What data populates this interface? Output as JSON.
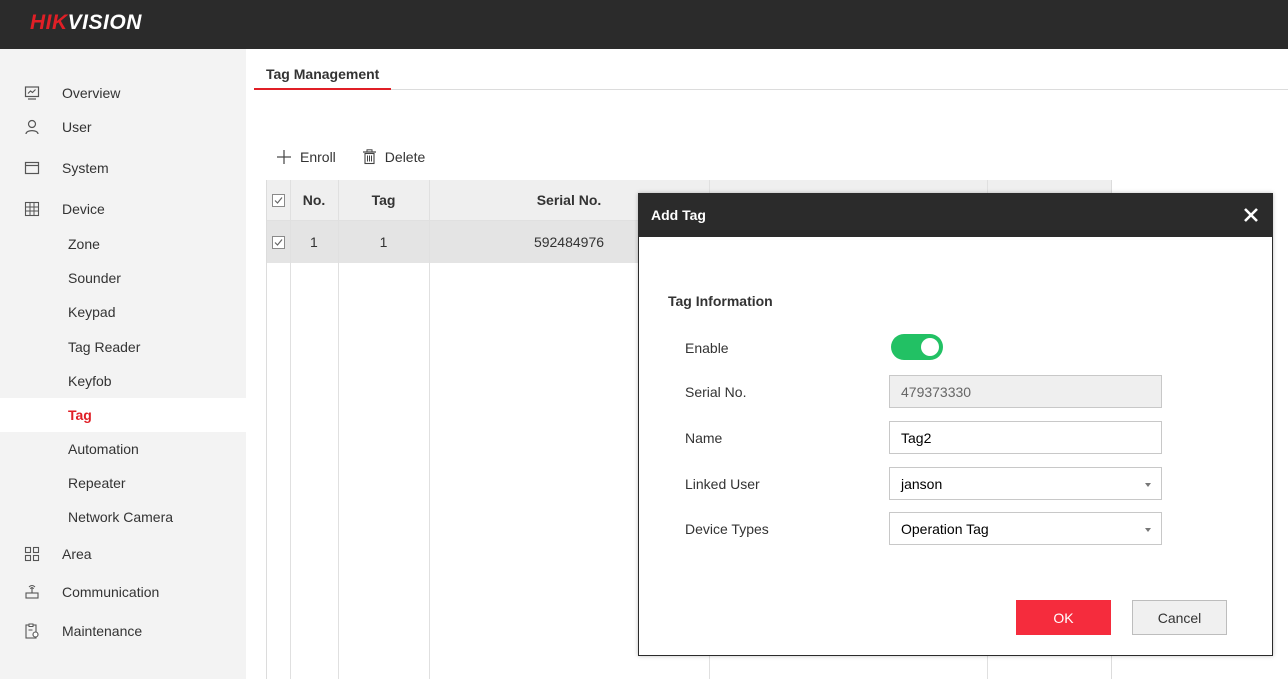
{
  "brand": {
    "part1": "HIK",
    "part2": "VISION"
  },
  "sidebar": {
    "items": [
      {
        "label": "Overview",
        "icon": "monitor-icon"
      },
      {
        "label": "User",
        "icon": "user-icon"
      },
      {
        "label": "System",
        "icon": "window-icon"
      },
      {
        "label": "Device",
        "icon": "grid-icon"
      },
      {
        "label": "Zone"
      },
      {
        "label": "Sounder"
      },
      {
        "label": "Keypad"
      },
      {
        "label": "Tag Reader"
      },
      {
        "label": "Keyfob"
      },
      {
        "label": "Tag",
        "active": true
      },
      {
        "label": "Automation"
      },
      {
        "label": "Repeater"
      },
      {
        "label": "Network Camera"
      },
      {
        "label": "Area",
        "icon": "area-icon"
      },
      {
        "label": "Communication",
        "icon": "antenna-icon"
      },
      {
        "label": "Maintenance",
        "icon": "clipboard-gear-icon"
      }
    ]
  },
  "main": {
    "tab_label": "Tag Management",
    "toolbar": {
      "enroll_label": "Enroll",
      "delete_label": "Delete"
    },
    "table": {
      "columns": [
        "No.",
        "Tag",
        "Serial No."
      ],
      "rows": [
        {
          "no": "1",
          "tag": "1",
          "serial": "592484976",
          "checked": true
        }
      ]
    }
  },
  "dialog": {
    "title": "Add Tag",
    "section_title": "Tag Information",
    "enable_label": "Enable",
    "enable_on": true,
    "serial_label": "Serial No.",
    "serial_value": "479373330",
    "name_label": "Name",
    "name_value": "Tag2",
    "linked_user_label": "Linked User",
    "linked_user_value": "janson",
    "device_types_label": "Device Types",
    "device_types_value": "Operation Tag",
    "ok_label": "OK",
    "cancel_label": "Cancel"
  },
  "colors": {
    "brand_red": "#e01f26",
    "header_dark": "#2b2b2b",
    "toggle_green": "#22c164",
    "ok_red": "#f52c3d"
  }
}
